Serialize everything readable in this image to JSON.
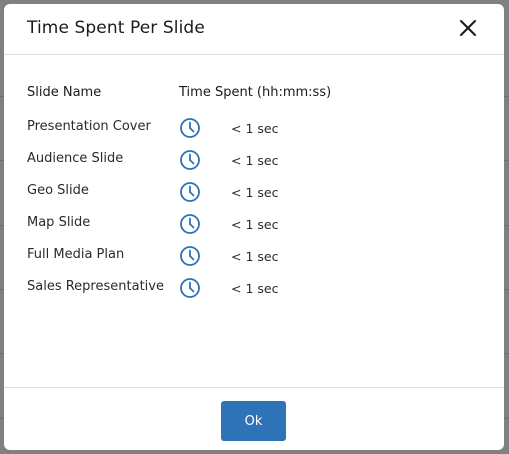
{
  "modal": {
    "title": "Time Spent Per Slide",
    "columns": {
      "name": "Slide Name",
      "time": "Time Spent (hh:mm:ss)"
    },
    "rows": [
      {
        "name": "Presentation Cover",
        "time": "< 1 sec"
      },
      {
        "name": "Audience Slide",
        "time": "< 1 sec"
      },
      {
        "name": "Geo Slide",
        "time": "< 1 sec"
      },
      {
        "name": "Map Slide",
        "time": "< 1 sec"
      },
      {
        "name": "Full Media Plan",
        "time": "< 1 sec"
      },
      {
        "name": "Sales Representative",
        "time": "< 1 sec"
      }
    ],
    "ok_label": "Ok",
    "icons": {
      "close": "close-icon",
      "row": "clock-icon"
    }
  },
  "colors": {
    "accent": "#2e73b8",
    "overlay": "#808080"
  }
}
